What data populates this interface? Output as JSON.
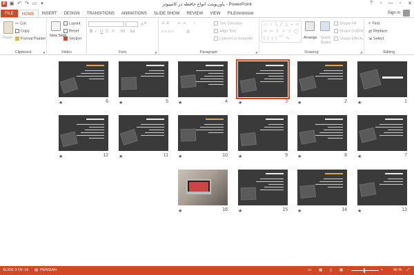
{
  "titlebar": {
    "title": "پاورپوینت انواع حافظه در کامپیوتر - PowerPoint",
    "signin": "Sign in",
    "help": "?",
    "minimize": "—",
    "restore": "▫",
    "close": "✕"
  },
  "tabs": [
    "FILE",
    "HOME",
    "INSERT",
    "DESIGN",
    "TRANSITIONS",
    "ANIMATIONS",
    "SLIDE SHOW",
    "REVIEW",
    "VIEW",
    "FILEminimizer"
  ],
  "ribbon": {
    "clipboard": {
      "label": "Clipboard",
      "paste": "Paste",
      "cut": "Cut",
      "copy": "Copy",
      "format_painter": "Format Painter"
    },
    "slides": {
      "label": "Slides",
      "new_slide": "New Slide",
      "layout": "Layout",
      "reset": "Reset",
      "section": "Section"
    },
    "font": {
      "label": "Font"
    },
    "paragraph": {
      "label": "Paragraph",
      "text_direction": "Text Direction",
      "align_text": "Align Text",
      "convert_smartart": "Convert to SmartArt"
    },
    "drawing": {
      "label": "Drawing",
      "arrange": "Arrange",
      "quick_styles": "Quick Styles",
      "shape_fill": "Shape Fill",
      "shape_outline": "Shape Outline",
      "shape_effects": "Shape Effects"
    },
    "editing": {
      "label": "Editing",
      "find": "Find",
      "replace": "Replace",
      "select": "Select"
    }
  },
  "slides": [
    {
      "n": "1",
      "kind": "title"
    },
    {
      "n": "2",
      "kind": "content"
    },
    {
      "n": "3",
      "kind": "content",
      "selected": true
    },
    {
      "n": "4",
      "kind": "content"
    },
    {
      "n": "5",
      "kind": "content"
    },
    {
      "n": "6",
      "kind": "content"
    },
    {
      "n": "7",
      "kind": "content"
    },
    {
      "n": "8",
      "kind": "content"
    },
    {
      "n": "9",
      "kind": "content"
    },
    {
      "n": "10",
      "kind": "content"
    },
    {
      "n": "11",
      "kind": "content"
    },
    {
      "n": "12",
      "kind": "content"
    },
    {
      "n": "13",
      "kind": "content"
    },
    {
      "n": "14",
      "kind": "content"
    },
    {
      "n": "15",
      "kind": "content"
    },
    {
      "n": "16",
      "kind": "photo"
    }
  ],
  "status": {
    "slide_info": "SLIDE 3 OF 16",
    "language": "PERSIAN",
    "zoom": "50 %",
    "zoom_minus": "-",
    "zoom_plus": "+"
  },
  "colors": {
    "accent": "#d24726"
  }
}
